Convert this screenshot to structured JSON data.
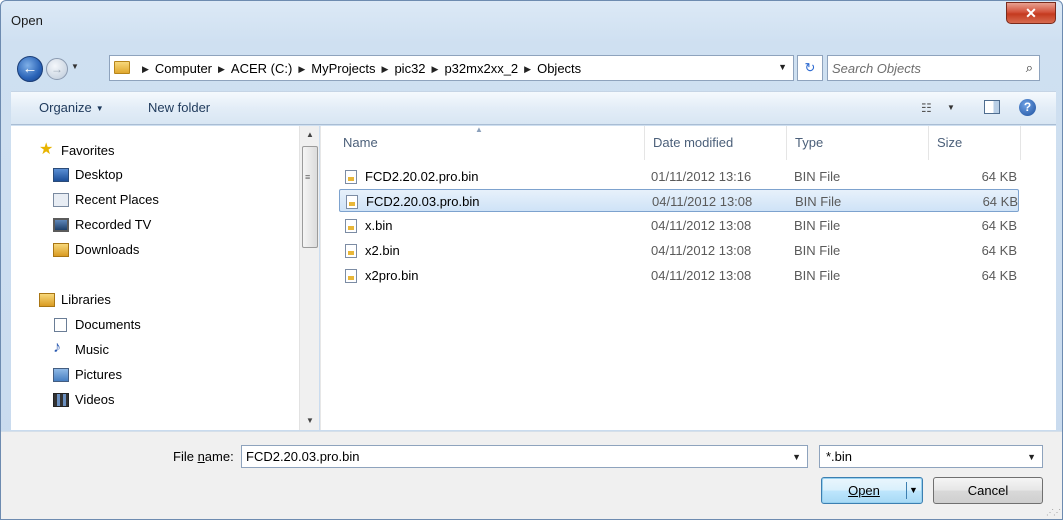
{
  "window": {
    "title": "Open",
    "close_glyph": "✕"
  },
  "address": {
    "crumbs": [
      "Computer",
      "ACER (C:)",
      "MyProjects",
      "pic32",
      "p32mx2xx_2",
      "Objects"
    ],
    "search_placeholder": "Search Objects"
  },
  "toolbar": {
    "organize_label": "Organize",
    "new_folder_label": "New folder"
  },
  "nav": {
    "favorites_label": "Favorites",
    "favorites": [
      "Desktop",
      "Recent Places",
      "Recorded TV",
      "Downloads"
    ],
    "libraries_label": "Libraries",
    "libraries": [
      "Documents",
      "Music",
      "Pictures",
      "Videos"
    ]
  },
  "columns": {
    "name": "Name",
    "date": "Date modified",
    "type": "Type",
    "size": "Size"
  },
  "files": [
    {
      "name": "FCD2.20.02.pro.bin",
      "date": "01/11/2012 13:16",
      "type": "BIN File",
      "size": "64 KB"
    },
    {
      "name": "FCD2.20.03.pro.bin",
      "date": "04/11/2012 13:08",
      "type": "BIN File",
      "size": "64 KB",
      "selected": true
    },
    {
      "name": "x.bin",
      "date": "04/11/2012 13:08",
      "type": "BIN File",
      "size": "64 KB"
    },
    {
      "name": "x2.bin",
      "date": "04/11/2012 13:08",
      "type": "BIN File",
      "size": "64 KB"
    },
    {
      "name": "x2pro.bin",
      "date": "04/11/2012 13:08",
      "type": "BIN File",
      "size": "64 KB"
    }
  ],
  "bottom": {
    "filename_label_prefix": "File ",
    "filename_label_accel": "n",
    "filename_label_suffix": "ame:",
    "filename_value": "FCD2.20.03.pro.bin",
    "filter_value": "*.bin",
    "open_label": "Open",
    "cancel_label": "Cancel"
  },
  "colors": {
    "accent": "#3c7fb1",
    "selection": "#cfe3f7",
    "link": "#1e395b"
  }
}
